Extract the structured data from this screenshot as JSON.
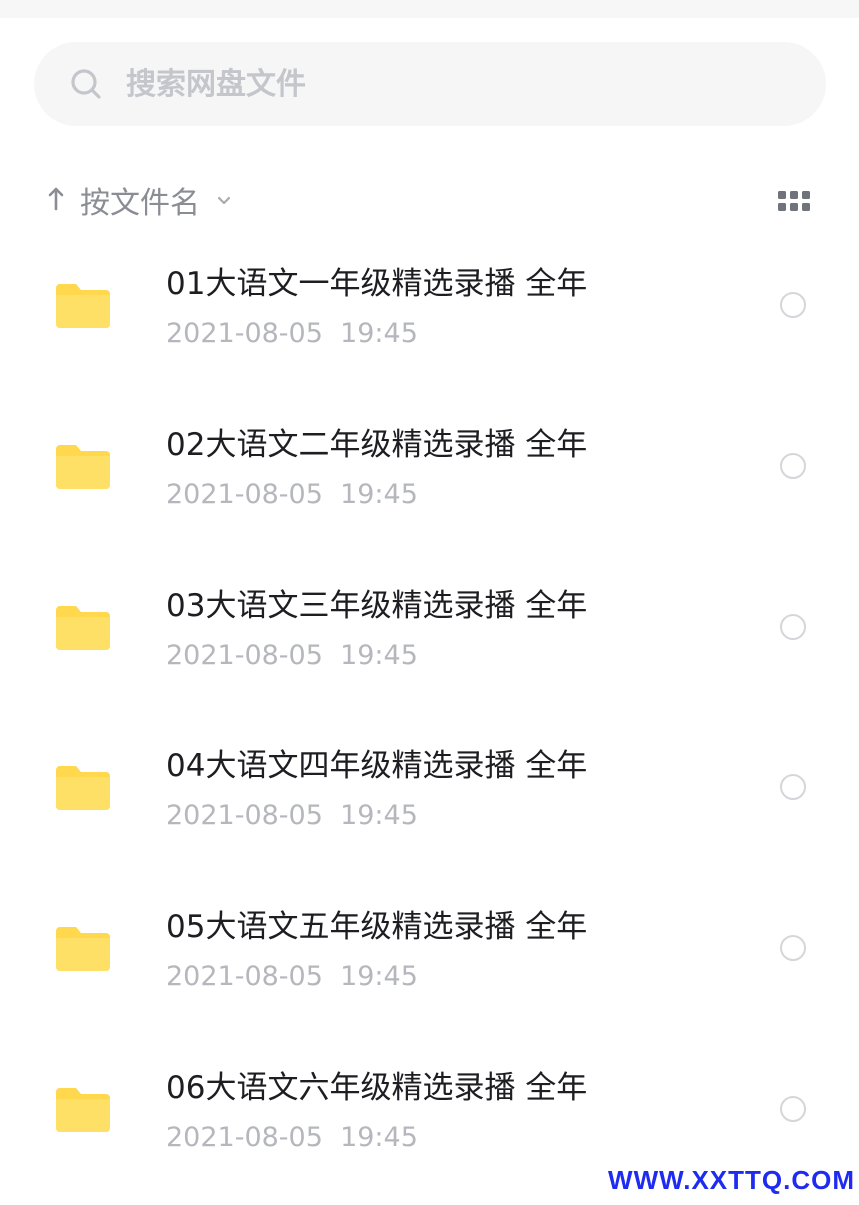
{
  "search": {
    "placeholder": "搜索网盘文件"
  },
  "sort": {
    "label": "按文件名"
  },
  "files": [
    {
      "name": "01大语文一年级精选录播 全年",
      "date": "2021-08-05  19:45"
    },
    {
      "name": "02大语文二年级精选录播 全年",
      "date": "2021-08-05  19:45"
    },
    {
      "name": "03大语文三年级精选录播 全年",
      "date": "2021-08-05  19:45"
    },
    {
      "name": "04大语文四年级精选录播 全年",
      "date": "2021-08-05  19:45"
    },
    {
      "name": "05大语文五年级精选录播 全年",
      "date": "2021-08-05  19:45"
    },
    {
      "name": "06大语文六年级精选录播 全年",
      "date": "2021-08-05  19:45"
    }
  ],
  "watermark": "WWW.XXTTQ.COM",
  "colors": {
    "folder": "#ffd84d",
    "accent_text": "#1d1d22",
    "muted_text": "#b5b7bd",
    "watermark": "#1f2bf0"
  },
  "icons": {
    "search": "search-icon",
    "sort": "sort-arrow-up-icon",
    "chevron": "chevron-down-icon",
    "view": "grid-view-icon",
    "folder": "folder-icon"
  }
}
